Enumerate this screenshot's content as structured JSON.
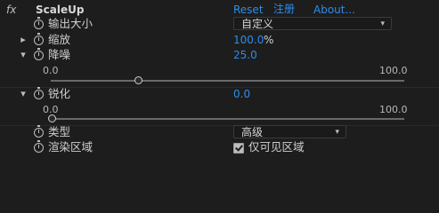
{
  "header": {
    "fx_symbol": "fx",
    "effect_name": "ScaleUp",
    "reset_label": "Reset",
    "register_label": "注册",
    "about_label": "About..."
  },
  "params": {
    "output_size": {
      "label": "输出大小",
      "value": "自定义"
    },
    "scale": {
      "label": "缩放",
      "value": "100.0",
      "unit": "%"
    },
    "denoise": {
      "label": "降噪",
      "value": "25.0",
      "min": "0.0",
      "max": "100.0",
      "slider_fraction": 0.25
    },
    "sharpen": {
      "label": "锐化",
      "value": "0.0",
      "min": "0.0",
      "max": "100.0",
      "slider_fraction": 0.0
    },
    "type": {
      "label": "类型",
      "value": "高级"
    },
    "render_region": {
      "label": "渲染区域",
      "checkbox_label": "仅可见区域",
      "checked": true
    }
  },
  "icons": {
    "twisty_collapsed": "▸",
    "twisty_expanded": "▾",
    "dropdown": "▾"
  },
  "colors": {
    "background": "#1d1d1d",
    "link_blue": "#2d8ceb",
    "text": "#cfcfcf"
  }
}
